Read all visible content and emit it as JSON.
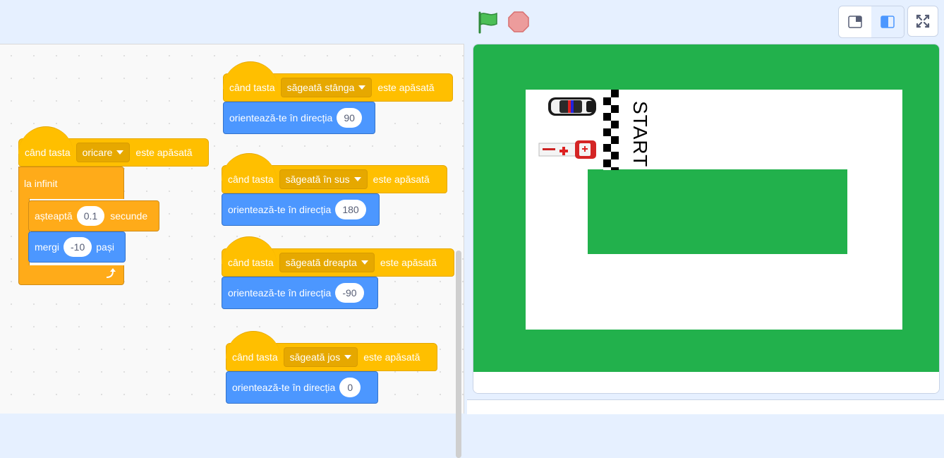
{
  "toolbar": {
    "flag_icon": "green-flag-icon",
    "stop_icon": "stop-icon",
    "mode_small_icon": "small-stage-icon",
    "mode_normal_icon": "normal-stage-icon",
    "fullscreen_icon": "fullscreen-icon"
  },
  "colors": {
    "events": "#ffbf00",
    "control": "#ffab19",
    "motion": "#4c97ff",
    "grass": "#22b14c",
    "track": "#ffffff"
  },
  "scripts": {
    "any_key": {
      "when": "când tasta",
      "key": "oricare",
      "pressed": "este apăsată",
      "forever": "la infinit",
      "wait_label": "așteaptă",
      "wait_value": "0.1",
      "wait_unit": "secunde",
      "move_label": "mergi",
      "move_value": "-10",
      "move_unit": "pași"
    },
    "left": {
      "when": "când tasta",
      "key": "săgeată stânga",
      "pressed": "este apăsată",
      "point_label": "orientează-te în direcția",
      "point_value": "90"
    },
    "up": {
      "when": "când tasta",
      "key": "săgeată în sus",
      "pressed": "este apăsată",
      "point_label": "orientează-te în direcția",
      "point_value": "180"
    },
    "right": {
      "when": "când tasta",
      "key": "săgeată dreapta",
      "pressed": "este apăsată",
      "point_label": "orientează-te în direcția",
      "point_value": "-90"
    },
    "down": {
      "when": "când tasta",
      "key": "săgeată jos",
      "pressed": "este apăsată",
      "point_label": "orientează-te în direcția",
      "point_value": "0"
    }
  },
  "stage": {
    "start_text": "START",
    "sprites": [
      "police-car",
      "ambulance"
    ]
  }
}
